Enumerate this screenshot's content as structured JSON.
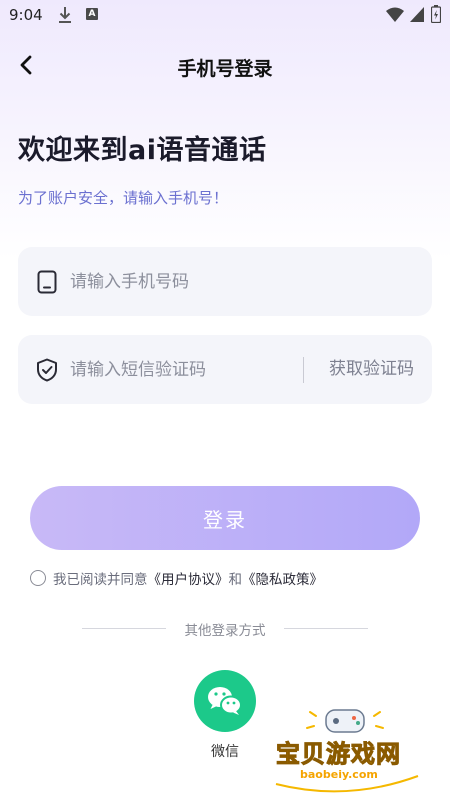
{
  "status_bar": {
    "time": "9:04"
  },
  "nav": {
    "title": "手机号登录"
  },
  "welcome": {
    "title": "欢迎来到ai语音通话",
    "subtitle": "为了账户安全，请输入手机号！"
  },
  "phone_field": {
    "placeholder": "请输入手机号码",
    "value": ""
  },
  "code_field": {
    "placeholder": "请输入短信验证码",
    "value": "",
    "get_code_label": "获取验证码"
  },
  "login_button": {
    "label": "登录"
  },
  "agreement": {
    "prefix": "我已阅读并同意",
    "user_agreement": "《用户协议》",
    "connector": "和",
    "privacy_policy": "《隐私政策》"
  },
  "other_login": {
    "label": "其他登录方式",
    "wechat_label": "微信"
  },
  "watermark": {
    "text": "宝贝游戏网",
    "url": "baobeiy.com"
  },
  "colors": {
    "accent": "#b2a8f8",
    "wechat": "#1cc98a",
    "subtitle": "#6b70d0"
  }
}
